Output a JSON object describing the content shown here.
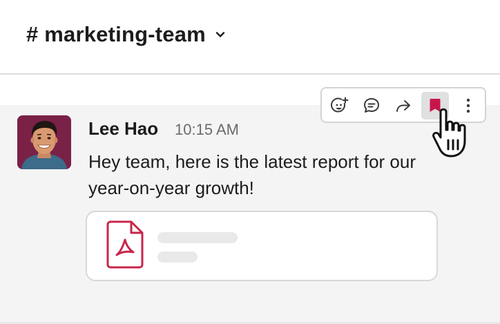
{
  "channel": {
    "name": "# marketing-team",
    "chevron_icon": "chevron-down-icon"
  },
  "message": {
    "sender": "Lee Hao",
    "timestamp": "10:15 AM",
    "text": "Hey team, here is the latest report for our year-on-year growth!",
    "avatar_icon": "user-avatar"
  },
  "attachment": {
    "icon": "pdf-file-icon",
    "accent_color": "#c8264b"
  },
  "toolbar": {
    "actions": [
      {
        "name": "add-reaction",
        "icon": "emoji-add-icon"
      },
      {
        "name": "reply-in-thread",
        "icon": "thread-bubble-icon"
      },
      {
        "name": "share",
        "icon": "forward-arrow-icon"
      },
      {
        "name": "save-for-later",
        "icon": "bookmark-icon",
        "active": true
      },
      {
        "name": "more-actions",
        "icon": "more-vertical-icon"
      }
    ]
  },
  "colors": {
    "bookmark": "#c8164b",
    "message_background": "#f4f4f4",
    "active_button": "#e0e0e0"
  }
}
